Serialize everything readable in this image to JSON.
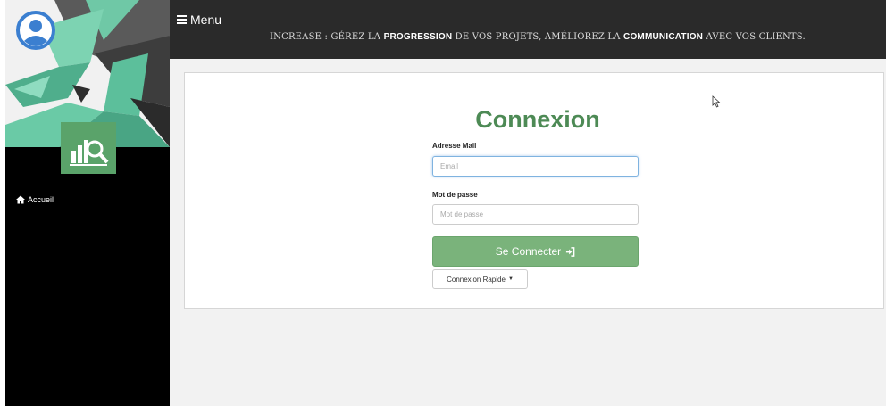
{
  "sidebar": {
    "nav_items": [
      {
        "label": "Accueil",
        "icon": "home-icon"
      }
    ]
  },
  "topbar": {
    "menu_label": "Menu",
    "tagline": {
      "part1": "Increase : Gérez la ",
      "bold1": "progression",
      "part2": " de vos projets, améliorez la ",
      "bold2": "communication",
      "part3": " avec vos clients."
    }
  },
  "login": {
    "title": "Connexion",
    "email_label": "Adresse Mail",
    "email_placeholder": "Email",
    "password_label": "Mot de passe",
    "password_placeholder": "Mot de passe",
    "submit_label": "Se Connecter",
    "quick_login_label": "Connexion Rapide"
  },
  "colors": {
    "primary_green": "#7ab37b",
    "title_green": "#4d8a55",
    "topbar_bg": "#2a2a2a",
    "sidebar_bg": "#000000"
  }
}
